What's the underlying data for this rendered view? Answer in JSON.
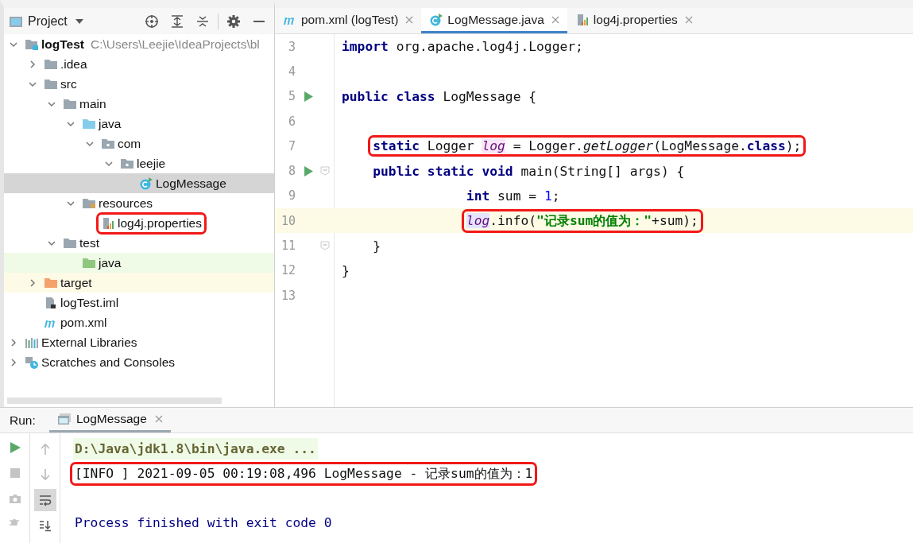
{
  "project_panel": {
    "title": "Project",
    "tree": [
      {
        "label": "logTest",
        "path": "C:\\Users\\Leejie\\IdeaProjects\\bl",
        "kind": "module",
        "expanded": true,
        "selected": false,
        "children": [
          {
            "label": ".idea",
            "kind": "folder",
            "expanded": false,
            "selected": false
          },
          {
            "label": "src",
            "kind": "folder",
            "expanded": true,
            "selected": false,
            "children": [
              {
                "label": "main",
                "kind": "folder",
                "expanded": true,
                "selected": false,
                "children": [
                  {
                    "label": "java",
                    "kind": "source-folder",
                    "expanded": true,
                    "selected": false,
                    "children": [
                      {
                        "label": "com",
                        "kind": "package",
                        "expanded": true,
                        "selected": false,
                        "children": [
                          {
                            "label": "leejie",
                            "kind": "package",
                            "expanded": true,
                            "selected": false,
                            "children": [
                              {
                                "label": "LogMessage",
                                "kind": "class",
                                "selected": true
                              }
                            ]
                          }
                        ]
                      }
                    ]
                  },
                  {
                    "label": "resources",
                    "kind": "resources-folder",
                    "expanded": true,
                    "selected": false,
                    "children": [
                      {
                        "label": "log4j.properties",
                        "kind": "properties",
                        "selected": false,
                        "annotated": true
                      }
                    ]
                  }
                ]
              },
              {
                "label": "test",
                "kind": "folder",
                "expanded": true,
                "selected": false,
                "children": [
                  {
                    "label": "java",
                    "kind": "test-folder",
                    "selected": false
                  }
                ]
              }
            ]
          },
          {
            "label": "target",
            "kind": "excluded-folder",
            "expanded": false,
            "selected": false
          },
          {
            "label": "logTest.iml",
            "kind": "iml",
            "selected": false
          },
          {
            "label": "pom.xml",
            "kind": "maven",
            "selected": false
          }
        ]
      },
      {
        "label": "External Libraries",
        "kind": "libraries",
        "expanded": false,
        "selected": false
      },
      {
        "label": "Scratches and Consoles",
        "kind": "scratches",
        "expanded": false,
        "selected": false
      }
    ]
  },
  "editor": {
    "tabs": [
      {
        "label": "pom.xml (logTest)",
        "kind": "maven",
        "selected": false
      },
      {
        "label": "LogMessage.java",
        "kind": "class",
        "selected": true
      },
      {
        "label": "log4j.properties",
        "kind": "properties",
        "selected": false
      }
    ],
    "lines": [
      {
        "no": "3",
        "current": false,
        "tokens": [
          {
            "t": "import",
            "kind": "kw"
          },
          {
            "t": " org.apache.log4j.Logger;",
            "kind": "plain"
          }
        ]
      },
      {
        "no": "4",
        "current": false
      },
      {
        "no": "5",
        "current": false,
        "run": true,
        "tokens": [
          {
            "t": "public class",
            "kind": "kw"
          },
          {
            "t": " LogMessage {",
            "kind": "plain"
          }
        ]
      },
      {
        "no": "6",
        "current": false
      },
      {
        "no": "7",
        "current": false,
        "annotated": true,
        "tokens": [
          {
            "t": "    static",
            "kind": "kw"
          },
          {
            "t": " Logger ",
            "kind": "plain"
          },
          {
            "t": "log",
            "kind": "field-decl"
          },
          {
            "t": " = Logger.",
            "kind": "plain"
          },
          {
            "t": "getLogger",
            "kind": "method"
          },
          {
            "t": "(LogMessage.",
            "kind": "plain"
          },
          {
            "t": "class",
            "kind": "kw"
          },
          {
            "t": ");",
            "kind": "plain"
          }
        ]
      },
      {
        "no": "8",
        "current": false,
        "run": true,
        "fold": true,
        "tokens": [
          {
            "t": "    public static void",
            "kind": "kw"
          },
          {
            "t": " main(String[] args) {",
            "kind": "plain"
          }
        ]
      },
      {
        "no": "9",
        "current": false,
        "tokens": [
          {
            "t": "                int",
            "kind": "kw"
          },
          {
            "t": " sum = ",
            "kind": "plain"
          },
          {
            "t": "1",
            "kind": "num"
          },
          {
            "t": ";",
            "kind": "plain"
          }
        ]
      },
      {
        "no": "10",
        "current": true,
        "annotated": true,
        "tokens": [
          {
            "t": "                log",
            "kind": "field-ref"
          },
          {
            "t": ".info(",
            "kind": "plain"
          },
          {
            "t": "\"记录sum的值为：\"",
            "kind": "string"
          },
          {
            "t": "+sum);",
            "kind": "plain"
          }
        ]
      },
      {
        "no": "11",
        "current": false,
        "fold": true,
        "tokens": [
          {
            "t": "    }",
            "kind": "plain"
          }
        ]
      },
      {
        "no": "12",
        "current": false,
        "tokens": [
          {
            "t": "}",
            "kind": "plain"
          }
        ]
      },
      {
        "no": "13",
        "current": false
      }
    ]
  },
  "run_panel": {
    "label": "Run:",
    "tab": "LogMessage",
    "tools": [
      {
        "kind": "up",
        "on": false
      },
      {
        "kind": "down",
        "on": false
      },
      {
        "kind": "wrap",
        "on": true
      },
      {
        "kind": "scroll-end",
        "on": false
      }
    ],
    "console": [
      {
        "kind": "command",
        "text": "D:\\Java\\jdk1.8\\bin\\java.exe ..."
      },
      {
        "kind": "log",
        "text": "[INFO ] 2021-09-05 00:19:08,496 LogMessage - 记录sum的值为：1",
        "annotated": true
      },
      {
        "kind": "exit",
        "text": "Process finished with exit code 0"
      }
    ]
  }
}
